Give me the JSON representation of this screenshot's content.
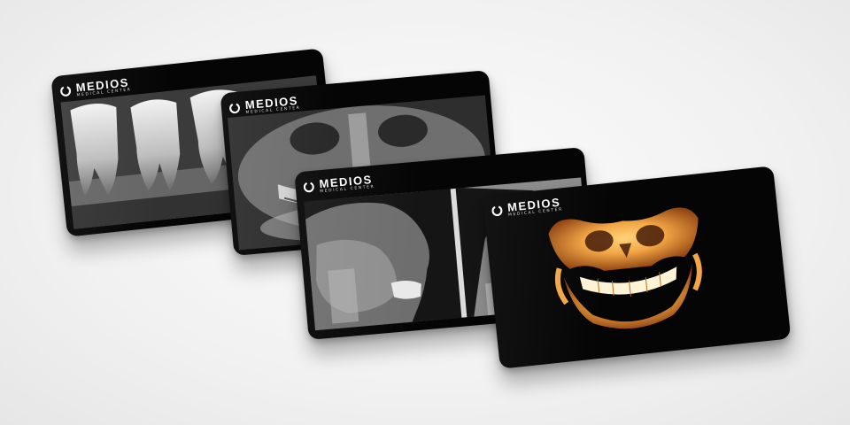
{
  "brand": {
    "name": "MEDIOS",
    "tagline": "MEDICAL CENTER"
  },
  "cards": [
    {
      "id": "card1",
      "image": "bitewing-xray"
    },
    {
      "id": "card2",
      "image": "panoramic-xray"
    },
    {
      "id": "card3",
      "image": "cephalometric-xray"
    },
    {
      "id": "card4",
      "image": "3d-cbct-jaw"
    }
  ],
  "colors": {
    "card_background": "#050505",
    "brand_text": "#ffffff",
    "jaw_highlight": "#f2a645",
    "jaw_shadow": "#8a3d0c"
  }
}
